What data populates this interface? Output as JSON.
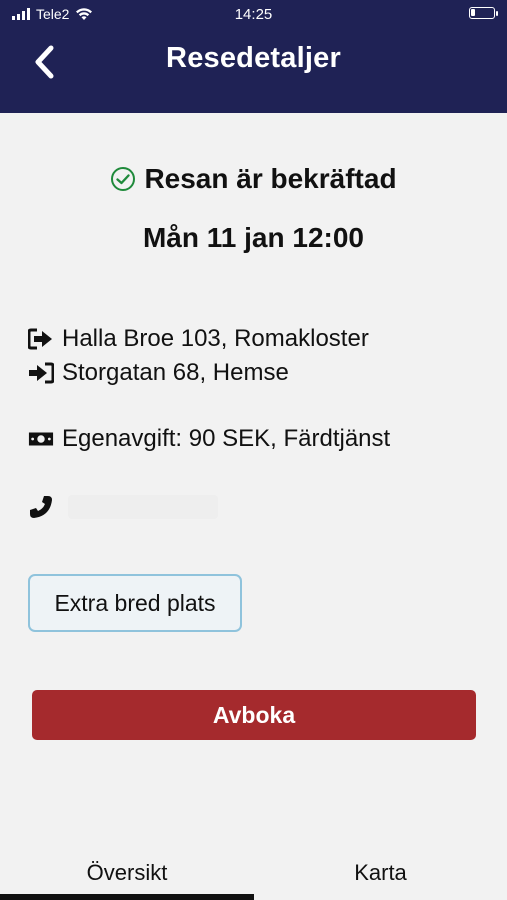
{
  "status_bar": {
    "carrier": "Tele2",
    "time": "14:25"
  },
  "header": {
    "title": "Resedetaljer",
    "back_icon": "chevron-left-icon"
  },
  "booking": {
    "status": "Resan är bekräftad",
    "status_color": "#1f8a3b",
    "datetime": "Mån 11 jan 12:00",
    "from": "Halla Broe 103, Romakloster",
    "to": "Storgatan 68, Hemse",
    "fee": "Egenavgift: 90 SEK, Färdtjänst",
    "phone": ""
  },
  "extras": {
    "chip_label": "Extra bred plats"
  },
  "actions": {
    "cancel_label": "Avboka",
    "cancel_color": "#a52a2d"
  },
  "tabs": [
    {
      "label": "Översikt",
      "active": true
    },
    {
      "label": "Karta",
      "active": false
    }
  ],
  "colors": {
    "header_bg": "#1f2255",
    "background": "#f2f2f2",
    "chip_border": "#8fc3dc"
  }
}
